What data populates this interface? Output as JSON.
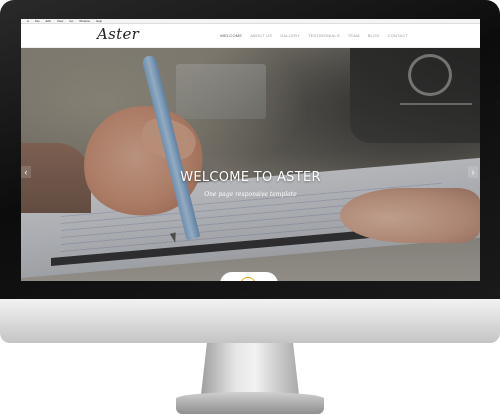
{
  "os_menubar": {
    "items": [
      "",
      "File",
      "Edit",
      "View",
      "Go",
      "Window",
      "Help"
    ]
  },
  "site": {
    "logo": "Aster",
    "nav": [
      "WELCOME",
      "ABOUT US",
      "GALLERY",
      "TESTIMONIALS",
      "TEAM",
      "BLOG",
      "CONTACT"
    ],
    "active_nav": "WELCOME"
  },
  "hero": {
    "title": "WELCOME TO ASTER",
    "subtitle": "One page responsive template",
    "prev_arrow": "‹",
    "next_arrow": "›"
  },
  "play_button": {
    "icon": "play-icon",
    "color": "#e6a81f"
  },
  "colors": {
    "accent": "#e6a81f",
    "bezel": "#111111",
    "stand": "#c4c4c4"
  }
}
